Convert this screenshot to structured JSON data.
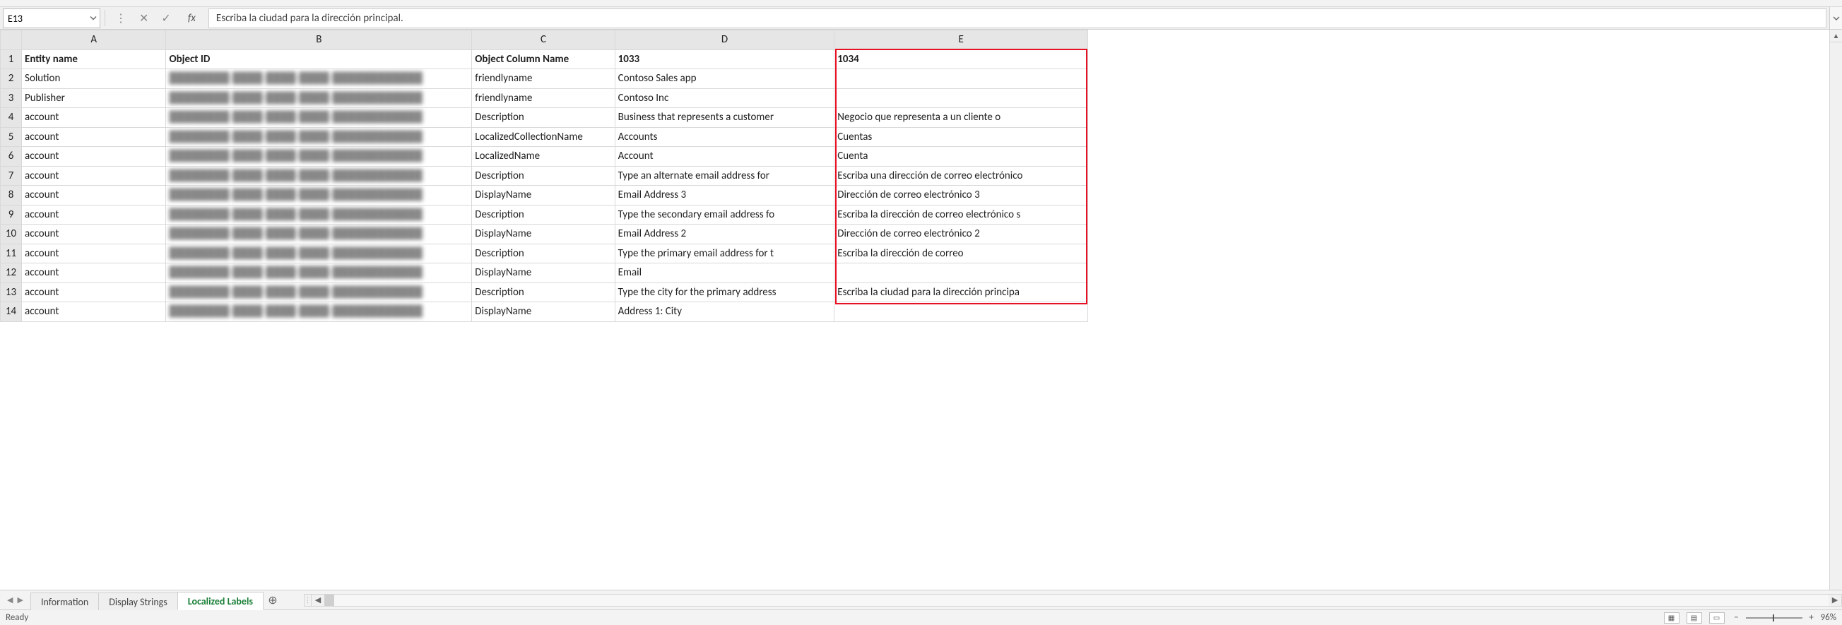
{
  "name_box": {
    "value": "E13"
  },
  "formula_bar": {
    "fx_label": "fx",
    "value": "Escriba la ciudad para la dirección principal."
  },
  "columns": [
    "A",
    "B",
    "C",
    "D",
    "E"
  ],
  "rows": [
    {
      "n": "1",
      "A": "Entity name",
      "B": "Object ID",
      "C": "Object Column Name",
      "D": "1033",
      "E": "1034",
      "header": true
    },
    {
      "n": "2",
      "A": "Solution",
      "B": "",
      "C": "friendlyname",
      "D": "Contoso Sales app",
      "E": ""
    },
    {
      "n": "3",
      "A": "Publisher",
      "B": "",
      "C": "friendlyname",
      "D": "Contoso Inc",
      "E": ""
    },
    {
      "n": "4",
      "A": "account",
      "B": "",
      "C": "Description",
      "D": "Business that represents a customer",
      "E": "Negocio que representa a un cliente o"
    },
    {
      "n": "5",
      "A": "account",
      "B": "",
      "C": "LocalizedCollectionName",
      "D": "Accounts",
      "E": "Cuentas"
    },
    {
      "n": "6",
      "A": "account",
      "B": "",
      "C": "LocalizedName",
      "D": "Account",
      "E": "Cuenta"
    },
    {
      "n": "7",
      "A": "account",
      "B": "",
      "C": "Description",
      "D": "Type an alternate email address for",
      "E": "Escriba una dirección de correo electrónico"
    },
    {
      "n": "8",
      "A": "account",
      "B": "",
      "C": "DisplayName",
      "D": "Email Address 3",
      "E": "Dirección de correo electrónico 3"
    },
    {
      "n": "9",
      "A": "account",
      "B": "",
      "C": "Description",
      "D": "Type the secondary email address fo",
      "E": "Escriba la dirección de correo electrónico s"
    },
    {
      "n": "10",
      "A": "account",
      "B": "",
      "C": "DisplayName",
      "D": "Email Address 2",
      "E": "Dirección de correo electrónico 2"
    },
    {
      "n": "11",
      "A": "account",
      "B": "",
      "C": "Description",
      "D": "Type the primary email address for t",
      "E": "Escriba la dirección de correo"
    },
    {
      "n": "12",
      "A": "account",
      "B": "",
      "C": "DisplayName",
      "D": "Email",
      "E": ""
    },
    {
      "n": "13",
      "A": "account",
      "B": "",
      "C": "Description",
      "D": "Type the city for the primary address",
      "E": "Escriba la ciudad para la dirección principa"
    },
    {
      "n": "14",
      "A": "account",
      "B": "",
      "C": "DisplayName",
      "D": "Address 1: City",
      "E": "",
      "clipped": true
    }
  ],
  "tabs": [
    {
      "label": "Information",
      "active": false
    },
    {
      "label": "Display Strings",
      "active": false
    },
    {
      "label": "Localized Labels",
      "active": true
    }
  ],
  "status": {
    "ready": "Ready",
    "zoom": "96%"
  }
}
